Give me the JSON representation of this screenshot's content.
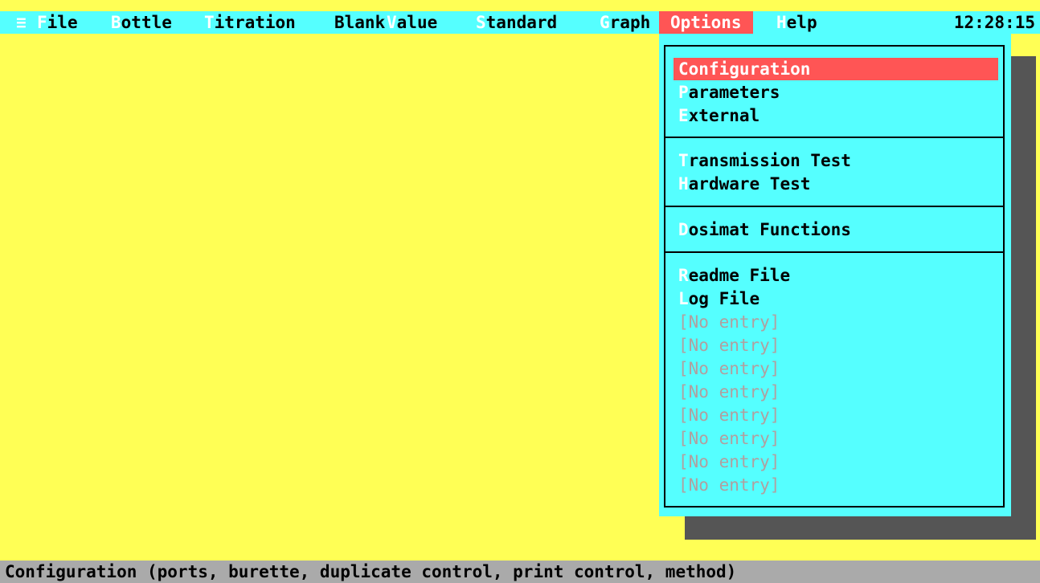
{
  "menubar": {
    "system_icon": "≡",
    "items": [
      {
        "hot": "F",
        "rest": "ile"
      },
      {
        "hot": "B",
        "rest": "ottle"
      },
      {
        "hot": "T",
        "rest": "itration"
      },
      {
        "hot": "",
        "rest": "Blank"
      },
      {
        "hot": "V",
        "rest": "alue"
      },
      {
        "hot": "S",
        "rest": "tandard"
      },
      {
        "hot": "G",
        "rest": "raph"
      },
      {
        "hot": "",
        "rest": "Options"
      },
      {
        "hot": "H",
        "rest": "elp"
      }
    ],
    "clock": "12:28:15"
  },
  "dropdown": {
    "items": [
      {
        "hot": "C",
        "rest": "onfiguration"
      },
      {
        "hot": "P",
        "rest": "arameters"
      },
      {
        "hot": "E",
        "rest": "xternal"
      },
      {
        "hot": "T",
        "rest": "ransmission Test"
      },
      {
        "hot": "H",
        "rest": "ardware Test"
      },
      {
        "hot": "D",
        "rest": "osimat Functions"
      },
      {
        "hot": "R",
        "rest": "eadme File"
      },
      {
        "hot": "L",
        "rest": "og File"
      }
    ],
    "no_entry": [
      "[No entry]",
      "[No entry]",
      "[No entry]",
      "[No entry]",
      "[No entry]",
      "[No entry]",
      "[No entry]",
      "[No entry]"
    ]
  },
  "statusbar": {
    "text": "Configuration (ports, burette, duplicate control, print control, method)"
  },
  "colors": {
    "background": "#ffff55",
    "menubar": "#55ffff",
    "highlight": "#ff5555",
    "statusbar": "#aaaaaa",
    "shadow": "#555555"
  }
}
